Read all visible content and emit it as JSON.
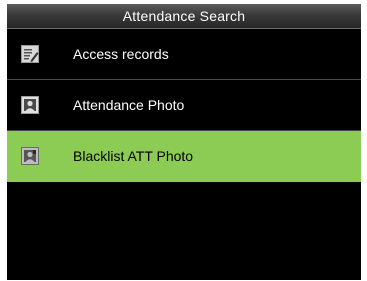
{
  "header": {
    "title": "Attendance Search"
  },
  "menu": {
    "items": [
      {
        "label": "Access records",
        "icon": "table-edit-icon",
        "selected": false
      },
      {
        "label": "Attendance Photo",
        "icon": "portrait-photo-icon",
        "selected": false
      },
      {
        "label": "Blacklist ATT Photo",
        "icon": "blacklist-photo-icon",
        "selected": true
      }
    ]
  },
  "colors": {
    "selection": "#8ccc54",
    "background": "#000000",
    "title_text": "#ffffff"
  }
}
